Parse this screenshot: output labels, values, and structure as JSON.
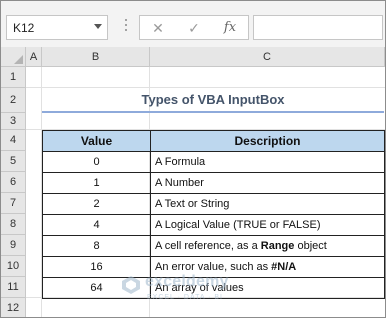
{
  "formula_bar": {
    "name_box": "K12",
    "cancel_glyph": "✕",
    "enter_glyph": "✓",
    "fx_label": "fx",
    "formula": ""
  },
  "columns": [
    {
      "label": ""
    },
    {
      "label": "A"
    },
    {
      "label": "B"
    },
    {
      "label": "C"
    }
  ],
  "rows": [
    "1",
    "2",
    "3",
    "4",
    "5",
    "6",
    "7",
    "8",
    "9",
    "10",
    "11",
    "12"
  ],
  "sheet": {
    "title": "Types of VBA InputBox",
    "table": {
      "headers": [
        "Value",
        "Description"
      ],
      "rows": [
        {
          "value": "0",
          "description": "A Formula"
        },
        {
          "value": "1",
          "description": "A Number"
        },
        {
          "value": "2",
          "description": "A Text or String"
        },
        {
          "value": "4",
          "description": "A Logical Value (TRUE or FALSE)"
        },
        {
          "value": "8",
          "description_pre": "A cell reference, as a ",
          "description_bold": "Range",
          "description_post": " object"
        },
        {
          "value": "16",
          "description_pre": "An error value, such as ",
          "description_bold": "#N/A",
          "description_post": ""
        },
        {
          "value": "64",
          "description": "An array of values"
        }
      ]
    }
  },
  "watermark": {
    "name": "exceldemy",
    "tagline": "EXCEL · DATA · BI"
  },
  "colors": {
    "header_fill": "#bdd7ee",
    "title_color": "#44546a",
    "title_underline": "#8eaadb",
    "grid_line": "#e1e1e1",
    "header_bg": "#e6e6e6"
  },
  "icons": [
    "dropdown-arrow-icon",
    "cancel-icon",
    "enter-icon",
    "fx-icon",
    "select-all-icon",
    "exceldemy-logo-icon"
  ]
}
